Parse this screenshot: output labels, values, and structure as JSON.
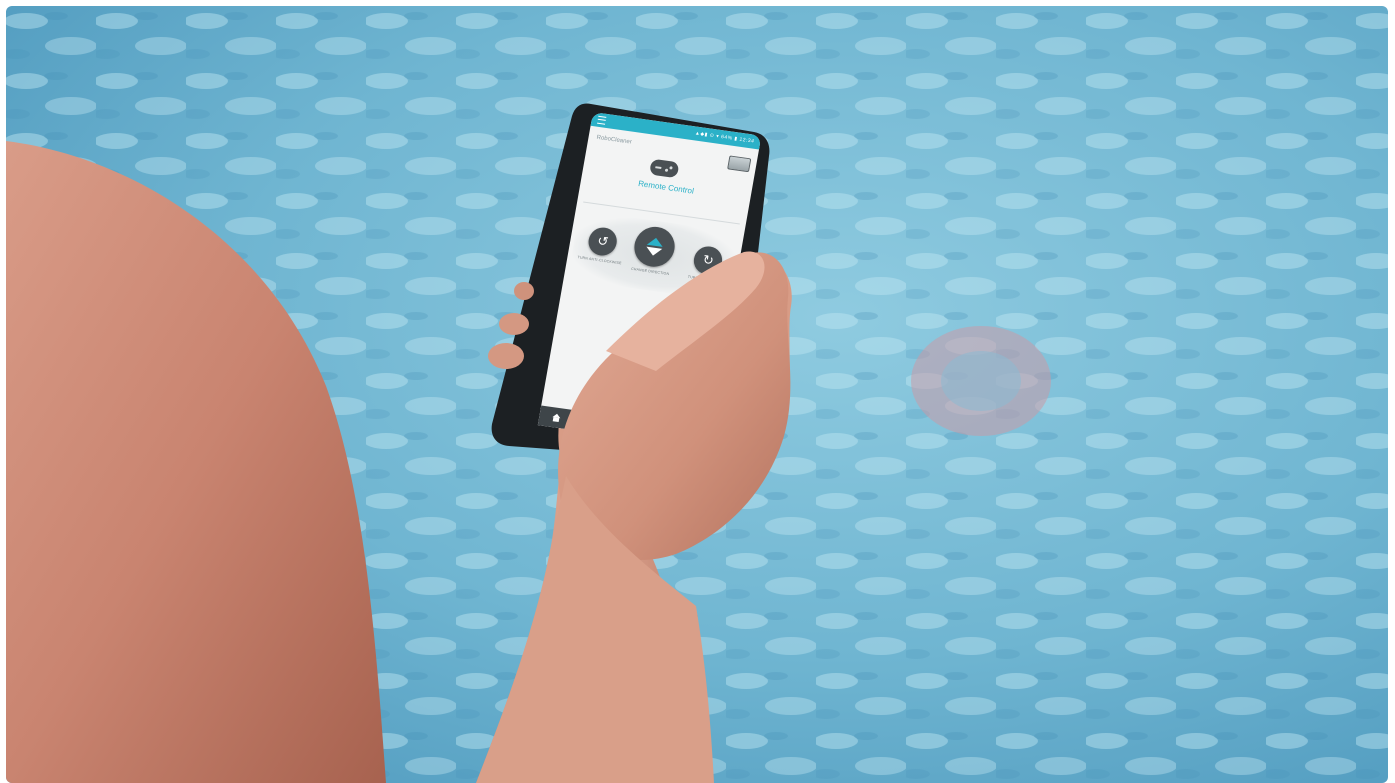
{
  "app": {
    "brand": "RoboCleaner",
    "screen_title": "Remote Control"
  },
  "status_bar": {
    "icons_text": "▲◆▮ ⊙ ▾ 64% ▮ 12:34"
  },
  "controls": {
    "turn_left_label": "TURN ANTI-CLOCKWISE",
    "change_direction_label": "CHANGE DIRECTION",
    "turn_right_label": "TURN CLOCKWISE"
  },
  "icons": {
    "menu": "hamburger-icon",
    "robot": "robot-icon",
    "gamepad": "gamepad-icon",
    "turn_left": "rotate-left-icon",
    "change_direction": "direction-arrows-icon",
    "turn_right": "rotate-right-icon",
    "home": "home-icon",
    "remote": "gamepad-icon"
  },
  "colors": {
    "accent": "#2bb1c8",
    "button": "#4a5054",
    "nav_bar": "#3e4549",
    "screen_bg": "#f3f4f4"
  }
}
